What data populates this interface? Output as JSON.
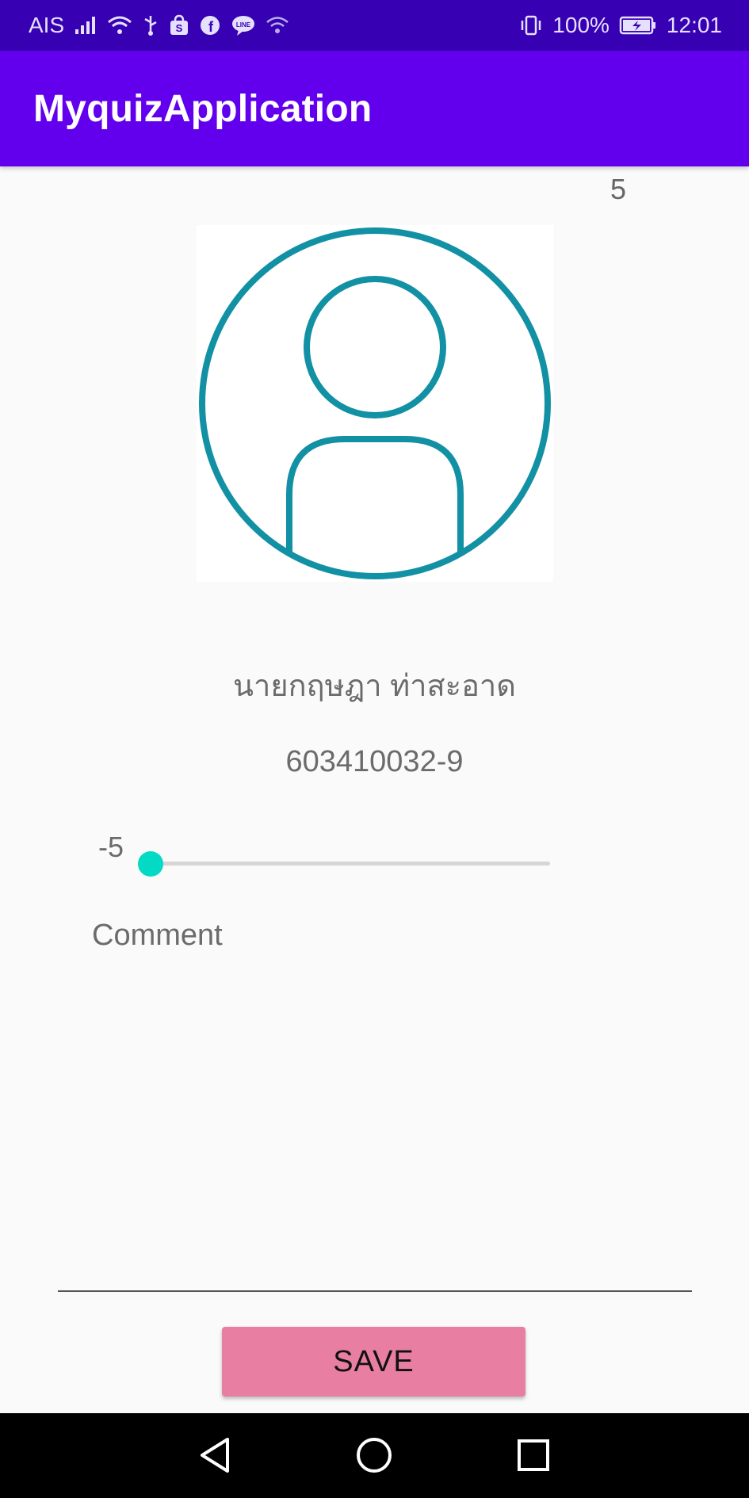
{
  "status_bar": {
    "carrier": "AIS",
    "battery_percent": "100%",
    "time": "12:01",
    "icons": [
      "signal-icon",
      "wifi-icon",
      "usb-icon",
      "shopee-icon",
      "facebook-icon",
      "line-icon",
      "wifi-calling-icon",
      "vibrate-icon",
      "battery-charging-icon"
    ]
  },
  "app_bar": {
    "title": "MyquizApplication"
  },
  "main": {
    "score": "5",
    "avatar_icon": "user-profile-icon",
    "name": "นายกฤษฎา ท่าสะอาด",
    "student_id": "603410032-9",
    "slider": {
      "label": "-5",
      "level_fraction": 0.0
    },
    "comment": {
      "placeholder": "Comment",
      "value": ""
    },
    "save_label": "SAVE"
  },
  "nav_bar": {
    "icons": [
      "back-icon",
      "home-icon",
      "recents-icon"
    ]
  },
  "colors": {
    "status_bar": "#3700b3",
    "app_bar": "#6200ee",
    "accent": "#03dac5",
    "avatar_stroke": "#1290a4",
    "save_button": "#e97ea3"
  }
}
